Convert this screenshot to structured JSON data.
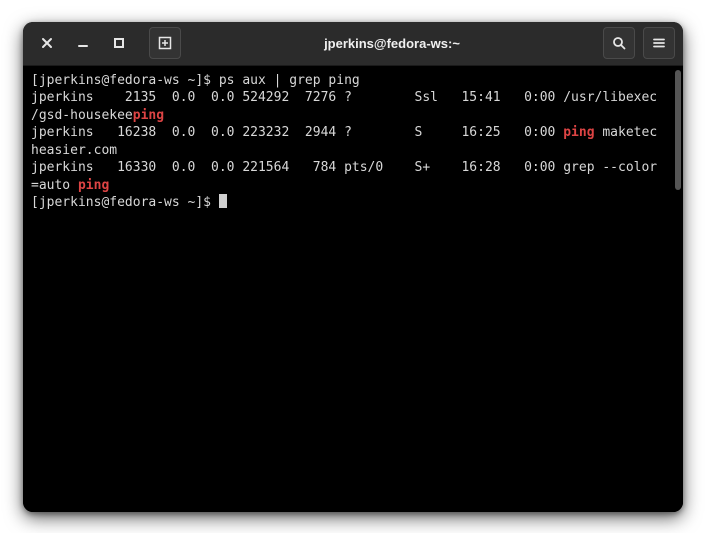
{
  "window": {
    "title": "jperkins@fedora-ws:~"
  },
  "prompt": "[jperkins@fedora-ws ~]$ ",
  "command": "ps aux | grep ping",
  "highlight": "ping",
  "ps": [
    {
      "user": "jperkins",
      "pid": "2135",
      "cpu": "0.0",
      "mem": "0.0",
      "vsz": "524292",
      "rss": "7276",
      "tty": "?",
      "stat": "Ssl",
      "start": "15:41",
      "time": "0:00",
      "cmd_pre": "/usr/libexec/gsd-housekee",
      "cmd_hit": "ping",
      "cmd_post": ""
    },
    {
      "user": "jperkins",
      "pid": "16238",
      "cpu": "0.0",
      "mem": "0.0",
      "vsz": "223232",
      "rss": "2944",
      "tty": "?",
      "stat": "S",
      "start": "16:25",
      "time": "0:00",
      "cmd_pre": "",
      "cmd_hit": "ping",
      "cmd_post": " maketecheasier.com"
    },
    {
      "user": "jperkins",
      "pid": "16330",
      "cpu": "0.0",
      "mem": "0.0",
      "vsz": "221564",
      "rss": "784",
      "tty": "pts/0",
      "stat": "S+",
      "start": "16:28",
      "time": "0:00",
      "cmd_pre": "grep --color=auto ",
      "cmd_hit": "ping",
      "cmd_post": ""
    }
  ]
}
